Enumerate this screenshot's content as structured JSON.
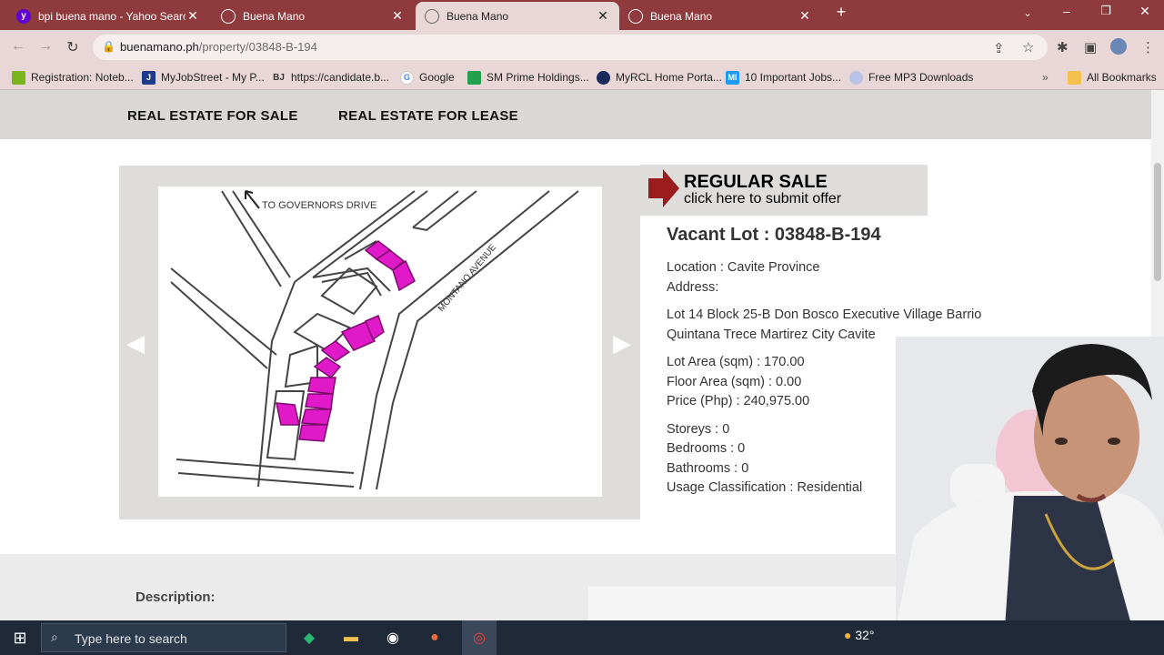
{
  "browser": {
    "tabs": [
      {
        "label": "bpi buena mano - Yahoo Search",
        "icon": "yahoo-icon",
        "active": false
      },
      {
        "label": "Buena Mano",
        "icon": "globe-icon",
        "active": false
      },
      {
        "label": "Buena Mano",
        "icon": "globe-icon",
        "active": true
      },
      {
        "label": "Buena Mano",
        "icon": "globe-icon",
        "active": false
      }
    ],
    "url_domain": "buenamano.ph",
    "url_path": "/property/03848-B-194",
    "bookmarks": [
      {
        "label": "Registration: Noteb...",
        "icon": "bookmark-green-icon"
      },
      {
        "label": "MyJobStreet - My P...",
        "icon": "jobstreet-icon"
      },
      {
        "label": "https://candidate.b...",
        "icon": "bj-icon"
      },
      {
        "label": "Google",
        "icon": "google-icon"
      },
      {
        "label": "SM Prime Holdings...",
        "icon": "sm-icon"
      },
      {
        "label": "MyRCL Home Porta...",
        "icon": "rcl-icon"
      },
      {
        "label": "10 Important Jobs...",
        "icon": "mi-icon"
      },
      {
        "label": "Free MP3 Downloads",
        "icon": "mp3-icon"
      }
    ],
    "all_bookmarks": "All Bookmarks"
  },
  "page": {
    "nav": {
      "for_sale": "REAL ESTATE FOR SALE",
      "for_lease": "REAL ESTATE FOR LEASE"
    },
    "map": {
      "label_governors": "TO GOVERNORS DRIVE",
      "label_montano": "MONTANO AVENUE"
    },
    "sale_banner": {
      "title": "REGULAR SALE",
      "subtitle": "click here to submit offer"
    },
    "property": {
      "title": "Vacant Lot : 03848-B-194",
      "location": "Location : Cavite Province",
      "address_label": "Address:",
      "address_line1": "Lot 14 Block 25-B Don Bosco Executive Village Barrio",
      "address_line2": "Quintana Trece Martirez City Cavite",
      "lot_area": "Lot Area (sqm) : 170.00",
      "floor_area": "Floor Area (sqm) : 0.00",
      "price": "Price (Php) : 240,975.00",
      "storeys": "Storeys : 0",
      "bedrooms": "Bedrooms : 0",
      "bathrooms": "Bathrooms : 0",
      "usage": "Usage Classification : Residential"
    },
    "description_label": "Description:"
  },
  "taskbar": {
    "search_placeholder": "Type here to search",
    "temperature": "32°"
  },
  "colors": {
    "tab_bar": "#8f3a3c",
    "toolbar": "#e9d6d6",
    "lot_magenta": "#e01ac8",
    "banner_arrow": "#9b1c1c"
  }
}
